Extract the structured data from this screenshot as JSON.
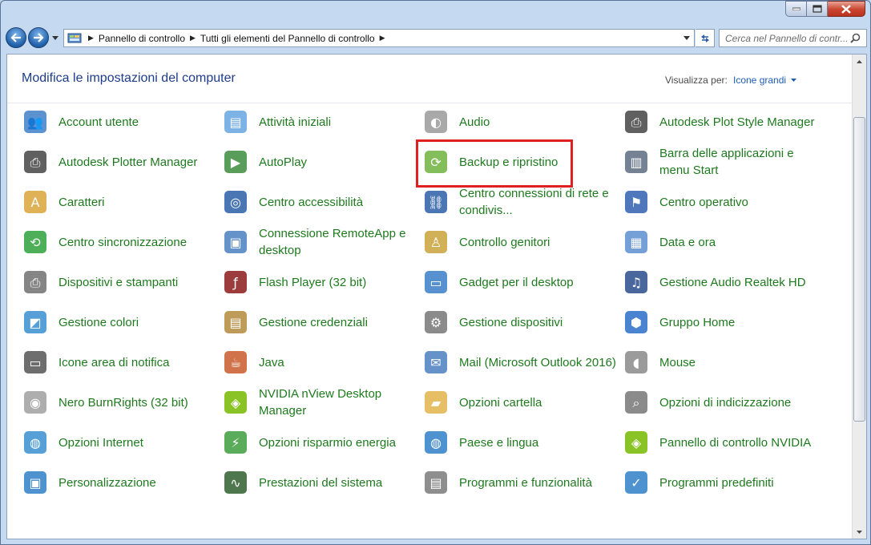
{
  "window": {
    "caption": {
      "minimize": "minimize",
      "maximize": "maximize",
      "close": "close"
    }
  },
  "nav": {
    "back": "back",
    "forward": "forward",
    "breadcrumbs": [
      "Pannello di controllo",
      "Tutti gli elementi del Pannello di controllo"
    ],
    "search_placeholder": "Cerca nel Pannello di contr..."
  },
  "header": {
    "title": "Modifica le impostazioni del computer",
    "view_label": "Visualizza per:",
    "view_value": "Icone grandi"
  },
  "highlight_color": "#e02020",
  "link_color": "#1e7a1e",
  "items": [
    {
      "label": "Account utente",
      "icon": "users-icon"
    },
    {
      "label": "Attività iniziali",
      "icon": "getting-started-icon"
    },
    {
      "label": "Audio",
      "icon": "speaker-icon"
    },
    {
      "label": "Autodesk Plot Style Manager",
      "icon": "printer-icon"
    },
    {
      "label": "Autodesk Plotter Manager",
      "icon": "plotter-icon"
    },
    {
      "label": "AutoPlay",
      "icon": "autoplay-icon"
    },
    {
      "label": "Backup e ripristino",
      "icon": "backup-icon",
      "highlighted": true
    },
    {
      "label": "Barra delle applicazioni e menu Start",
      "icon": "taskbar-icon"
    },
    {
      "label": "Caratteri",
      "icon": "fonts-icon"
    },
    {
      "label": "Centro accessibilità",
      "icon": "accessibility-icon"
    },
    {
      "label": "Centro connessioni di rete e condivis...",
      "icon": "network-icon"
    },
    {
      "label": "Centro operativo",
      "icon": "flag-icon"
    },
    {
      "label": "Centro sincronizzazione",
      "icon": "sync-icon"
    },
    {
      "label": "Connessione RemoteApp e desktop",
      "icon": "remoteapp-icon"
    },
    {
      "label": "Controllo genitori",
      "icon": "parental-icon"
    },
    {
      "label": "Data e ora",
      "icon": "calendar-icon"
    },
    {
      "label": "Dispositivi e stampanti",
      "icon": "devices-icon"
    },
    {
      "label": "Flash Player (32 bit)",
      "icon": "flash-icon"
    },
    {
      "label": "Gadget per il desktop",
      "icon": "gadget-icon"
    },
    {
      "label": "Gestione Audio Realtek HD",
      "icon": "realtek-icon"
    },
    {
      "label": "Gestione colori",
      "icon": "color-icon"
    },
    {
      "label": "Gestione credenziali",
      "icon": "vault-icon"
    },
    {
      "label": "Gestione dispositivi",
      "icon": "device-manager-icon"
    },
    {
      "label": "Gruppo Home",
      "icon": "homegroup-icon"
    },
    {
      "label": "Icone area di notifica",
      "icon": "notification-icon"
    },
    {
      "label": "Java",
      "icon": "java-icon"
    },
    {
      "label": "Mail (Microsoft Outlook 2016)",
      "icon": "mail-icon"
    },
    {
      "label": "Mouse",
      "icon": "mouse-icon"
    },
    {
      "label": "Nero BurnRights (32 bit)",
      "icon": "disc-icon"
    },
    {
      "label": "NVIDIA nView Desktop Manager",
      "icon": "nvidia-icon"
    },
    {
      "label": "Opzioni cartella",
      "icon": "folder-icon"
    },
    {
      "label": "Opzioni di indicizzazione",
      "icon": "indexing-icon"
    },
    {
      "label": "Opzioni Internet",
      "icon": "internet-icon"
    },
    {
      "label": "Opzioni risparmio energia",
      "icon": "power-icon"
    },
    {
      "label": "Paese e lingua",
      "icon": "globe-icon"
    },
    {
      "label": "Pannello di controllo NVIDIA",
      "icon": "nvidia-panel-icon"
    },
    {
      "label": "Personalizzazione",
      "icon": "personalize-icon"
    },
    {
      "label": "Prestazioni del sistema",
      "icon": "performance-icon"
    },
    {
      "label": "Programmi e funzionalità",
      "icon": "programs-icon"
    },
    {
      "label": "Programmi predefiniti",
      "icon": "default-programs-icon"
    }
  ]
}
